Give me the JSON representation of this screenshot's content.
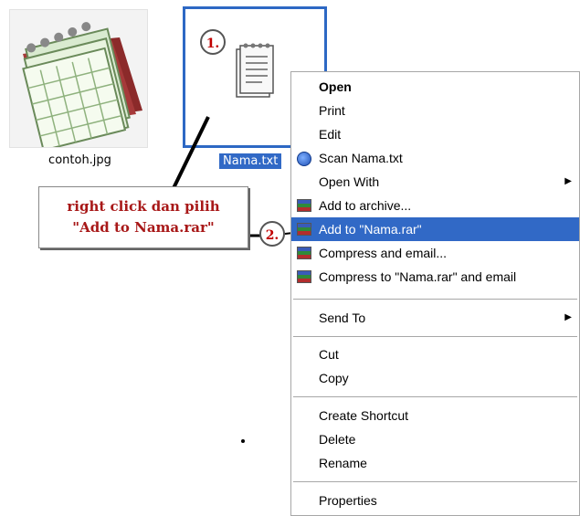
{
  "desktop": {
    "files": [
      {
        "label": "contoh.jpg",
        "icon": "calendar-icon"
      },
      {
        "label": "Nama.txt",
        "icon": "notepad-icon",
        "selected": true
      }
    ]
  },
  "annotations": {
    "step1": "1.",
    "step2": "2.",
    "callout_line1": "right click dan pilih",
    "callout_line2": "\"Add to Nama.rar\""
  },
  "context_menu": {
    "items": [
      {
        "label": "Open",
        "bold": true
      },
      {
        "label": "Print"
      },
      {
        "label": "Edit"
      },
      {
        "label": "Scan Nama.txt",
        "icon": "antivirus-scan-icon"
      },
      {
        "label": "Open With",
        "submenu": true
      },
      {
        "label": "Add to archive...",
        "icon": "winrar-icon"
      },
      {
        "label": "Add to \"Nama.rar\"",
        "icon": "winrar-icon",
        "highlighted": true
      },
      {
        "label": "Compress and email...",
        "icon": "winrar-icon"
      },
      {
        "label": "Compress to \"Nama.rar\" and email",
        "icon": "winrar-icon"
      },
      {
        "label": "Send To",
        "submenu": true
      },
      {
        "label": "Cut"
      },
      {
        "label": "Copy"
      },
      {
        "label": "Create Shortcut"
      },
      {
        "label": "Delete"
      },
      {
        "label": "Rename"
      },
      {
        "label": "Properties"
      }
    ]
  },
  "colors": {
    "selection": "#3169c6",
    "annotation_text": "#a81818"
  }
}
